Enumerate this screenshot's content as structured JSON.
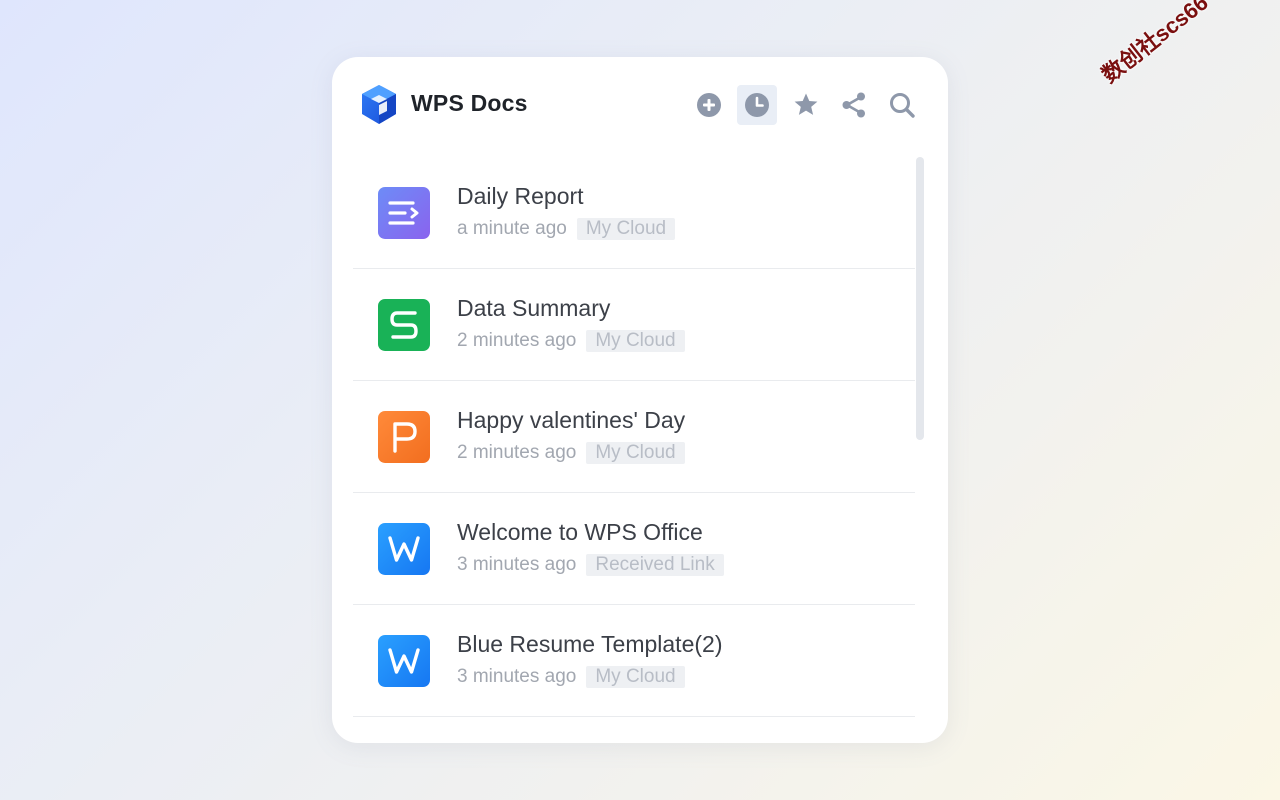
{
  "app": {
    "title": "WPS Docs"
  },
  "toolbar": {
    "icons": [
      "add-icon",
      "recent-clock-icon",
      "star-icon",
      "share-icon",
      "search-icon"
    ],
    "active": "recent-clock-icon",
    "active_color": "#e9eef6",
    "icon_color": "#8e98aa"
  },
  "files": [
    {
      "name": "Daily Report",
      "time": "a minute ago",
      "location": "My Cloud",
      "type": "note",
      "color": "#7c7af0"
    },
    {
      "name": "Data Summary",
      "time": "2 minutes ago",
      "location": "My Cloud",
      "type": "sheet",
      "color": "#1db35b"
    },
    {
      "name": "Happy valentines' Day",
      "time": "2 minutes ago",
      "location": "My Cloud",
      "type": "presentation",
      "color": "#f57c2c"
    },
    {
      "name": "Welcome to WPS Office",
      "time": "3 minutes ago",
      "location": "Received Link",
      "type": "writer",
      "color": "#1d8cf8"
    },
    {
      "name": "Blue Resume Template(2)",
      "time": "3 minutes ago",
      "location": "My Cloud",
      "type": "writer",
      "color": "#1d8cf8"
    }
  ],
  "watermark": "数创社scs66"
}
